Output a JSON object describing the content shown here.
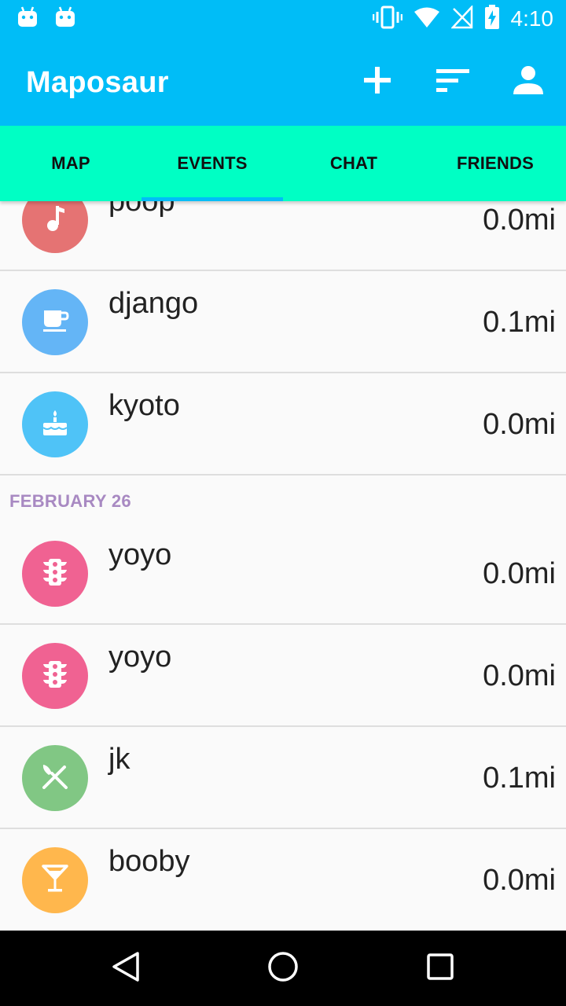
{
  "app": {
    "title": "Maposaur",
    "status_time": "4:10"
  },
  "toolbar": {
    "add_icon": "plus-icon",
    "sort_icon": "sort-icon",
    "profile_icon": "person-icon"
  },
  "tabs": [
    {
      "label": "MAP",
      "active": false
    },
    {
      "label": "EVENTS",
      "active": true
    },
    {
      "label": "CHAT",
      "active": false
    },
    {
      "label": "FRIENDS",
      "active": false
    }
  ],
  "events_a": [
    {
      "name": "poop",
      "distance": "0.0mi",
      "icon": "music-note-icon",
      "color": "#e57373"
    },
    {
      "name": "django",
      "distance": "0.1mi",
      "icon": "coffee-cup-icon",
      "color": "#64b5f6"
    },
    {
      "name": "kyoto",
      "distance": "0.0mi",
      "icon": "birthday-cake-icon",
      "color": "#4fc3f7"
    }
  ],
  "section": {
    "label": "FEBRUARY 26"
  },
  "events_b": [
    {
      "name": "yoyo",
      "distance": "0.0mi",
      "icon": "traffic-light-icon",
      "color": "#f06292"
    },
    {
      "name": "yoyo",
      "distance": "0.0mi",
      "icon": "traffic-light-icon",
      "color": "#f06292"
    },
    {
      "name": "jk",
      "distance": "0.1mi",
      "icon": "utensils-icon",
      "color": "#81c784"
    },
    {
      "name": "booby",
      "distance": "0.0mi",
      "icon": "cocktail-icon",
      "color": "#ffb74d"
    }
  ],
  "colors": {
    "app_bar": "#00bdf7",
    "tab_bar": "#00ffc4",
    "section_text": "#a889c2"
  }
}
